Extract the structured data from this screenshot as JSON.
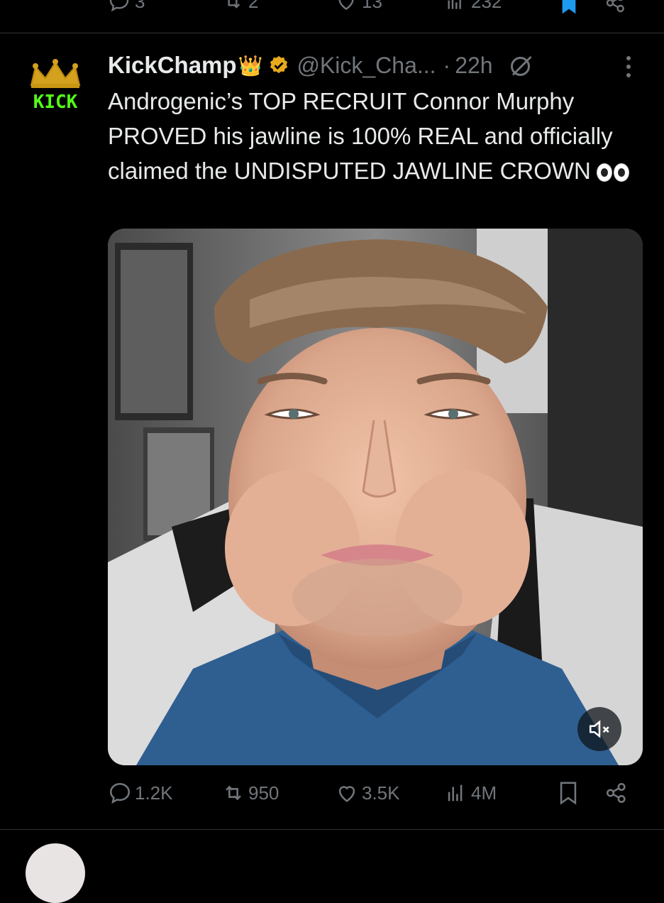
{
  "previous_tweet": {
    "replies": "3",
    "reposts": "2",
    "likes": "13",
    "views": "232"
  },
  "tweet": {
    "display_name": "KickChamp",
    "name_emoji": "👑",
    "handle": "@Kick_Cha...",
    "separator": "·",
    "time": "22h",
    "avatar_text": "KICK",
    "text": "Androgenic’s TOP RECRUIT Connor Murphy PROVED his jawline is 100% REAL and officially claimed the UNDISPUTED JAWLINE CROWN",
    "replies": "1.2K",
    "reposts": "950",
    "likes": "3.5K",
    "views": "4M"
  },
  "colors": {
    "background": "#000000",
    "text": "#e7e9ea",
    "muted": "#71767b",
    "verified": "#e8a91c",
    "bookmark_active": "#1d9bf0",
    "kick_green": "#53fc18"
  }
}
